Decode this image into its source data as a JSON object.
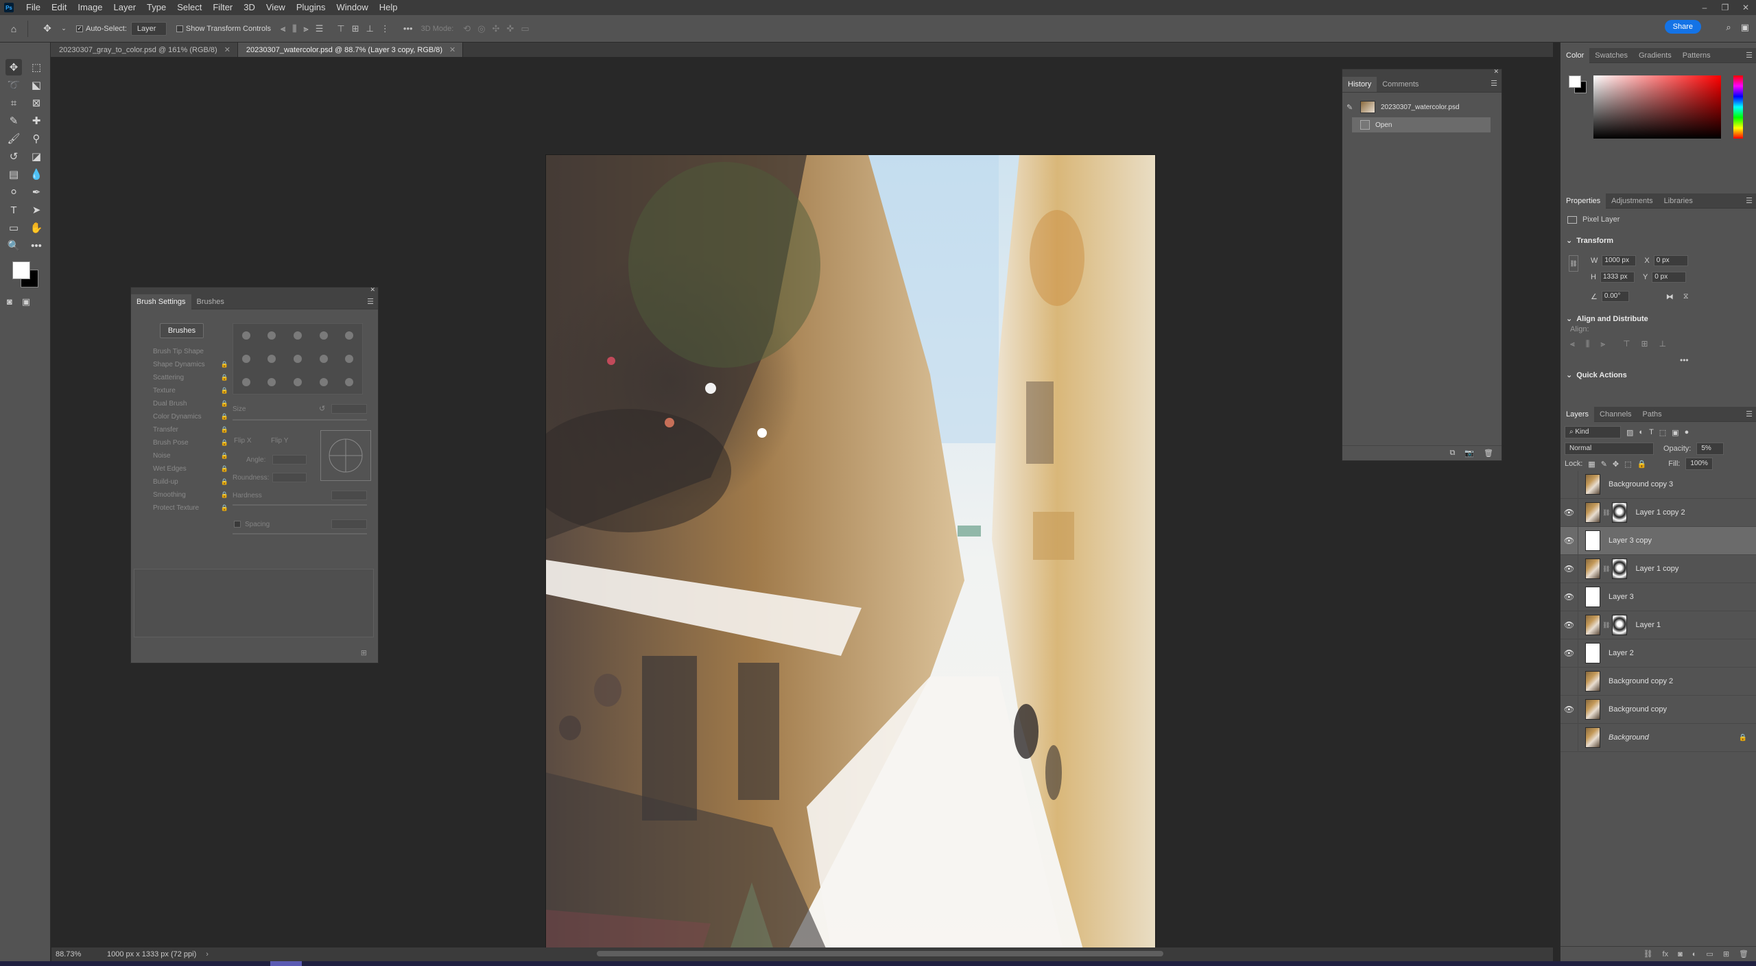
{
  "menu": [
    "File",
    "Edit",
    "Image",
    "Layer",
    "Type",
    "Select",
    "Filter",
    "3D",
    "View",
    "Plugins",
    "Window",
    "Help"
  ],
  "options": {
    "auto_select_label": "Auto-Select:",
    "auto_select_value": "Layer",
    "show_transform_label": "Show Transform Controls",
    "mode_3d_label": "3D Mode:",
    "share_label": "Share"
  },
  "tabs": [
    {
      "label": "20230307_gray_to_color.psd @ 161% (RGB/8)"
    },
    {
      "label": "20230307_watercolor.psd @ 88.7% (Layer 3 copy, RGB/8)"
    }
  ],
  "status": {
    "zoom": "88.73%",
    "dimensions": "1000 px x 1333 px (72 ppi)"
  },
  "color_panel": {
    "tabs": [
      "Color",
      "Swatches",
      "Gradients",
      "Patterns"
    ]
  },
  "properties": {
    "tabs": [
      "Properties",
      "Adjustments",
      "Libraries"
    ],
    "layer_type": "Pixel Layer",
    "transform_label": "Transform",
    "w_label": "W",
    "w_value": "1000 px",
    "h_label": "H",
    "h_value": "1333 px",
    "x_label": "X",
    "x_value": "0 px",
    "y_label": "Y",
    "y_value": "0 px",
    "angle_value": "0.00°",
    "align_section": "Align and Distribute",
    "align_label": "Align:",
    "quick_actions": "Quick Actions"
  },
  "layers_panel": {
    "tabs": [
      "Layers",
      "Channels",
      "Paths"
    ],
    "kind_label": "Kind",
    "blend_mode": "Normal",
    "opacity_label": "Opacity:",
    "opacity_value": "5%",
    "lock_label": "Lock:",
    "fill_label": "Fill:",
    "fill_value": "100%",
    "layers": [
      {
        "name": "Background copy 3",
        "visible": false,
        "thumb": "img",
        "mask": false,
        "selected": false
      },
      {
        "name": "Layer 1 copy 2",
        "visible": true,
        "thumb": "img",
        "mask": true,
        "selected": false
      },
      {
        "name": "Layer 3 copy",
        "visible": true,
        "thumb": "white",
        "mask": false,
        "selected": true
      },
      {
        "name": "Layer 1 copy",
        "visible": true,
        "thumb": "img",
        "mask": true,
        "selected": false
      },
      {
        "name": "Layer 3",
        "visible": true,
        "thumb": "white",
        "mask": false,
        "selected": false
      },
      {
        "name": "Layer 1",
        "visible": true,
        "thumb": "img",
        "mask": true,
        "selected": false
      },
      {
        "name": "Layer 2",
        "visible": true,
        "thumb": "white",
        "mask": false,
        "selected": false
      },
      {
        "name": "Background copy 2",
        "visible": false,
        "thumb": "img",
        "mask": false,
        "selected": false
      },
      {
        "name": "Background copy",
        "visible": true,
        "thumb": "img",
        "mask": false,
        "selected": false
      },
      {
        "name": "Background",
        "visible": false,
        "thumb": "img",
        "mask": false,
        "selected": false,
        "locked": true,
        "italic": true
      }
    ]
  },
  "history": {
    "tabs": [
      "History",
      "Comments"
    ],
    "snapshot": "20230307_watercolor.psd",
    "states": [
      "Open"
    ]
  },
  "brush_settings": {
    "tabs": [
      "Brush Settings",
      "Brushes"
    ],
    "brushes_button": "Brushes",
    "options": [
      "Brush Tip Shape",
      "Shape Dynamics",
      "Scattering",
      "Texture",
      "Dual Brush",
      "Color Dynamics",
      "Transfer",
      "Brush Pose",
      "Noise",
      "Wet Edges",
      "Build-up",
      "Smoothing",
      "Protect Texture"
    ],
    "size_label": "Size",
    "flip_x": "Flip X",
    "flip_y": "Flip Y",
    "angle_label": "Angle:",
    "roundness_label": "Roundness:",
    "hardness_label": "Hardness",
    "spacing_label": "Spacing"
  }
}
